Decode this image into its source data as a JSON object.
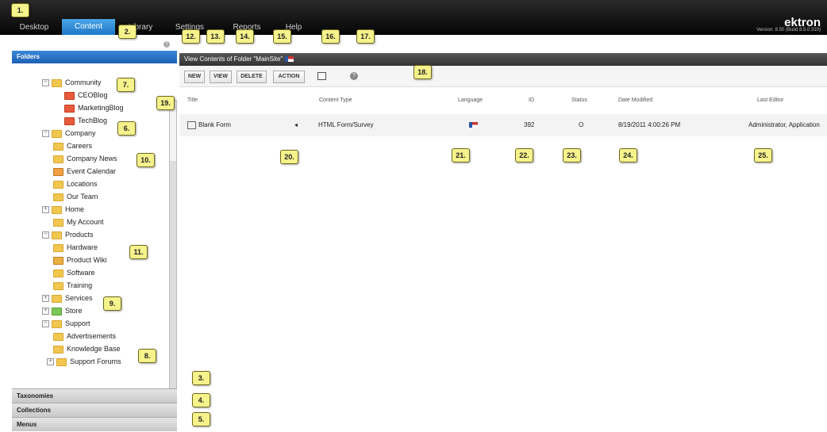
{
  "topbar": {
    "tabs": [
      "Desktop",
      "Content",
      "Library",
      "Settings",
      "Reports",
      "Help"
    ],
    "brand": "ektron",
    "version": "Version: 8.50 (Build 8.5.0.310)"
  },
  "left": {
    "folders_label": "Folders",
    "tree": [
      "Community",
      "CEOBlog",
      "MarketingBlog",
      "TechBlog",
      "Company",
      "Careers",
      "Company News",
      "Event Calendar",
      "Locations",
      "Our Team",
      "Home",
      "My Account",
      "Products",
      "Hardware",
      "Product Wiki",
      "Software",
      "Training",
      "Services",
      "Store",
      "Support",
      "Advertisements",
      "Knowledge Base",
      "Support Forums"
    ],
    "accordion": [
      "Taxonomies",
      "Collections",
      "Menus"
    ]
  },
  "main": {
    "view_title": "View Contents of Folder \"MainSite\"",
    "buttons": [
      "NEW",
      "VIEW",
      "DELETE",
      "ACTION"
    ],
    "columns": [
      "Title",
      "Content Type",
      "Language",
      "ID",
      "Status",
      "Date Modified",
      "Last Editor"
    ],
    "row": {
      "title": "Blank Form",
      "content_type": "HTML Form/Survey",
      "id": "392",
      "status": "O",
      "date_modified": "8/19/2011 4:00:26 PM",
      "last_editor": "Administrator, Application"
    }
  },
  "callouts": [
    "1.",
    "2.",
    "3.",
    "4.",
    "5.",
    "6.",
    "7.",
    "8.",
    "9.",
    "10.",
    "11.",
    "12.",
    "13.",
    "14.",
    "15.",
    "16.",
    "17.",
    "18.",
    "19.",
    "20.",
    "21.",
    "22.",
    "23.",
    "24.",
    "25."
  ],
  "colors": {
    "accent": "#1e78c8",
    "callout": "#f6f28c"
  }
}
